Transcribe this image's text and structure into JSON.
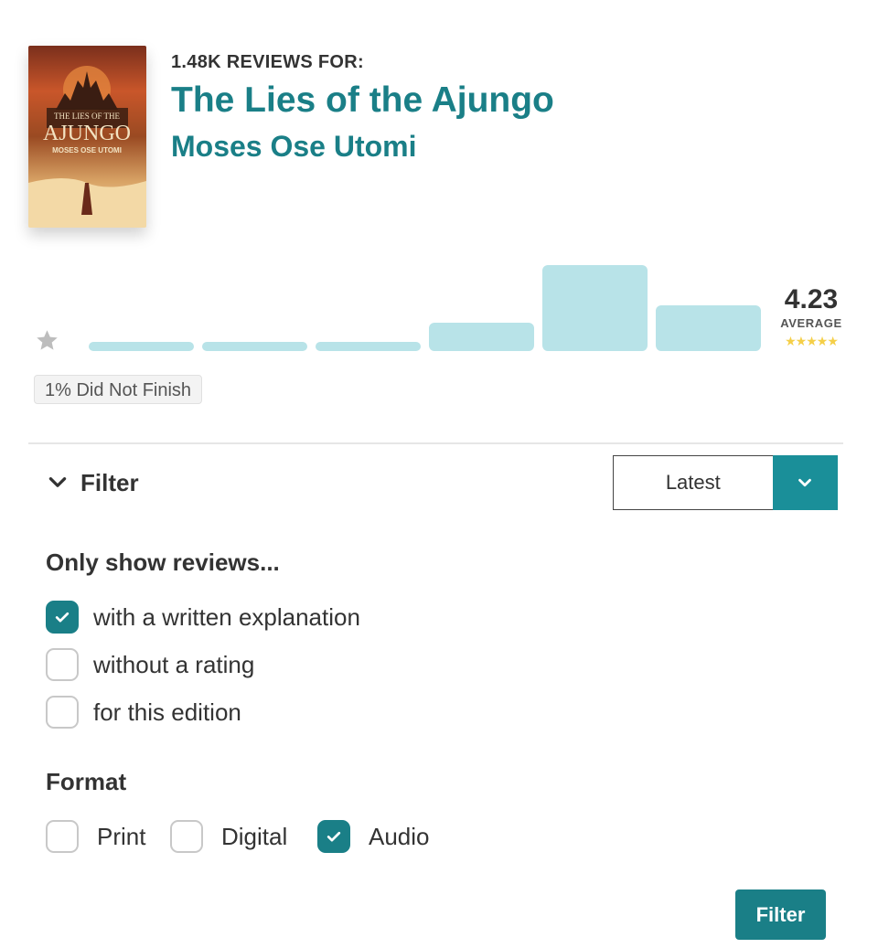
{
  "header": {
    "reviews_for": "1.48K REVIEWS FOR:",
    "title": "The Lies of the Ajungo",
    "author": "Moses Ose Utomi"
  },
  "cover": {
    "line1": "THE LIES OF THE",
    "line2": "AJUNGO",
    "line3": "MOSES OSE UTOMI"
  },
  "ratings": {
    "distribution_relative": [
      0.1,
      0.1,
      0.1,
      0.3,
      0.9,
      0.48
    ],
    "average": "4.23",
    "average_label": "AVERAGE",
    "stars_glyphs": "★★★★★",
    "bar_color": "#b8e3e8",
    "star_color": "#f5cf48",
    "dnf": "1% Did Not Finish"
  },
  "filter": {
    "toggle_label": "Filter",
    "sort_selected": "Latest",
    "only_show_heading": "Only show reviews...",
    "options": [
      {
        "label": "with a written explanation",
        "checked": true
      },
      {
        "label": "without a rating",
        "checked": false
      },
      {
        "label": "for this edition",
        "checked": false
      }
    ],
    "format_heading": "Format",
    "formats": [
      {
        "label": "Print",
        "checked": false
      },
      {
        "label": "Digital",
        "checked": false
      },
      {
        "label": "Audio",
        "checked": true
      }
    ],
    "submit_label": "Filter"
  },
  "colors": {
    "accent": "#1a7f87",
    "dropdown_bg": "#1a8f99"
  }
}
